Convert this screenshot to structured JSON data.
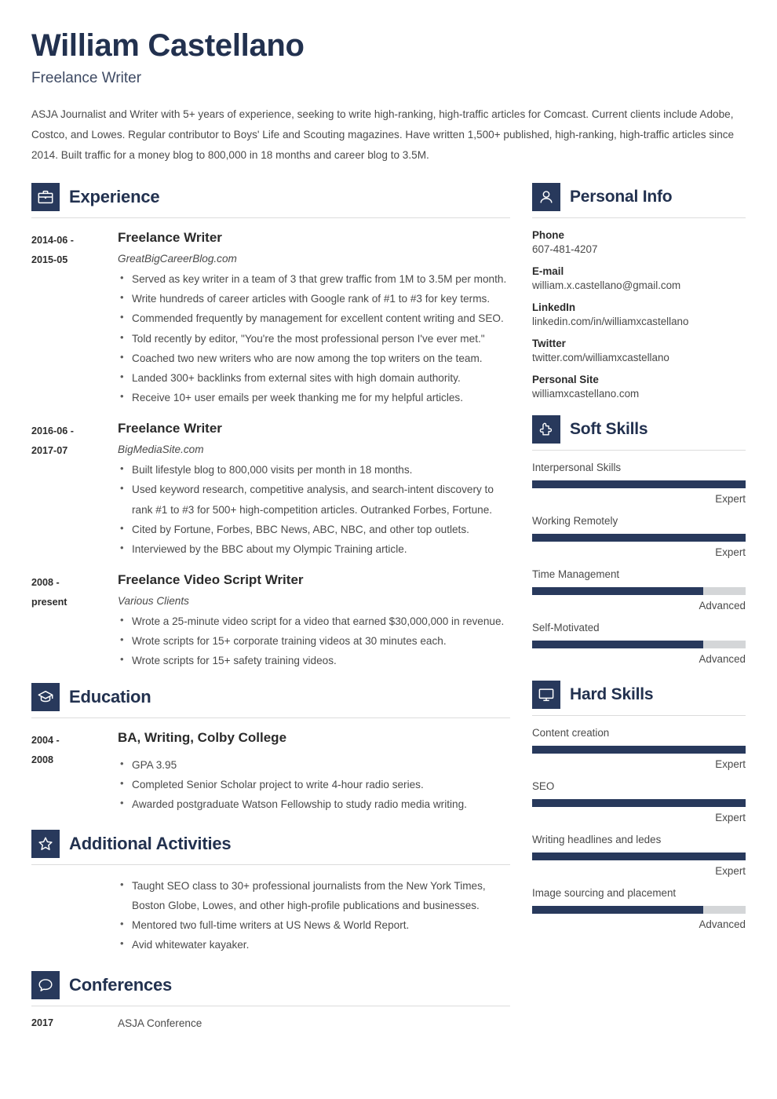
{
  "header": {
    "name": "William Castellano",
    "job_title": "Freelance Writer",
    "summary": "ASJA Journalist and Writer with 5+ years of experience, seeking to write high-ranking, high-traffic articles for Comcast. Current clients include Adobe, Costco, and Lowes. Regular contributor to Boys' Life and Scouting magazines. Have written 1,500+ published, high-ranking, high-traffic articles since 2014. Built traffic for a money blog to 800,000 in 18 months and career blog to 3.5M."
  },
  "sections": {
    "experience": {
      "title": "Experience",
      "icon": "briefcase-icon",
      "entries": [
        {
          "dates": "2014-06 - 2015-05",
          "role": "Freelance Writer",
          "company": "GreatBigCareerBlog.com",
          "bullets": [
            "Served as key writer in a team of 3 that grew traffic from 1M to 3.5M per month.",
            "Write hundreds of career articles with Google rank of #1 to #3 for key terms.",
            "Commended frequently by management for excellent content writing and SEO.",
            "Told recently by editor, \"You're the most professional person I've ever met.\"",
            "Coached two new writers who are now among the top writers on the team.",
            "Landed 300+ backlinks from external sites with high domain authority.",
            "Receive 10+ user emails per week thanking me for my helpful articles."
          ]
        },
        {
          "dates": "2016-06 - 2017-07",
          "role": "Freelance Writer",
          "company": "BigMediaSite.com",
          "bullets": [
            "Built lifestyle blog to 800,000 visits per month in 18 months.",
            "Used keyword research, competitive analysis, and search-intent discovery to rank #1 to #3 for 500+ high-competition articles. Outranked Forbes, Fortune.",
            "Cited by Fortune, Forbes, BBC News, ABC, NBC, and other top outlets.",
            "Interviewed by the BBC about my Olympic Training article."
          ]
        },
        {
          "dates": "2008 - present",
          "role": "Freelance Video Script Writer",
          "company": "Various Clients",
          "bullets": [
            "Wrote a 25-minute video script for a video that earned $30,000,000 in revenue.",
            "Wrote scripts for 15+ corporate training videos at 30 minutes each.",
            "Wrote scripts for 15+ safety training videos."
          ]
        }
      ]
    },
    "education": {
      "title": "Education",
      "icon": "graduation-cap-icon",
      "entries": [
        {
          "dates": "2004 - 2008",
          "degree": "BA, Writing, Colby College",
          "bullets": [
            "GPA 3.95",
            "Completed Senior Scholar project to write 4-hour radio series.",
            "Awarded postgraduate Watson Fellowship to study radio media writing."
          ]
        }
      ]
    },
    "additional_activities": {
      "title": "Additional Activities",
      "icon": "star-icon",
      "bullets": [
        "Taught SEO class to 30+ professional journalists from the New York Times, Boston Globe, Lowes, and other high-profile publications and businesses.",
        "Mentored two full-time writers at US News & World Report.",
        "Avid whitewater kayaker."
      ]
    },
    "conferences": {
      "title": "Conferences",
      "icon": "speech-bubble-icon",
      "rows": [
        {
          "year": "2017",
          "name": "ASJA Conference"
        }
      ]
    },
    "personal_info": {
      "title": "Personal Info",
      "icon": "person-icon",
      "items": [
        {
          "label": "Phone",
          "value": "607-481-4207"
        },
        {
          "label": "E-mail",
          "value": "william.x.castellano@gmail.com"
        },
        {
          "label": "LinkedIn",
          "value": "linkedin.com/in/williamxcastellano"
        },
        {
          "label": "Twitter",
          "value": "twitter.com/williamxcastellano"
        },
        {
          "label": "Personal Site",
          "value": "williamxcastellano.com"
        }
      ]
    },
    "soft_skills": {
      "title": "Soft Skills",
      "icon": "puzzle-piece-icon",
      "skills": [
        {
          "name": "Interpersonal Skills",
          "level": "Expert",
          "percent": 100
        },
        {
          "name": "Working Remotely",
          "level": "Expert",
          "percent": 100
        },
        {
          "name": "Time Management",
          "level": "Advanced",
          "percent": 80
        },
        {
          "name": "Self-Motivated",
          "level": "Advanced",
          "percent": 80
        }
      ]
    },
    "hard_skills": {
      "title": "Hard Skills",
      "icon": "monitor-icon",
      "skills": [
        {
          "name": "Content creation",
          "level": "Expert",
          "percent": 100
        },
        {
          "name": "SEO",
          "level": "Expert",
          "percent": 100
        },
        {
          "name": "Writing headlines and ledes",
          "level": "Expert",
          "percent": 100
        },
        {
          "name": "Image sourcing and placement",
          "level": "Advanced",
          "percent": 80
        }
      ]
    }
  },
  "theme": {
    "accent_navy": "#28395c",
    "heading_navy": "#22314f",
    "bar_track": "#d4d6d8",
    "rule": "#dcdcdc"
  }
}
